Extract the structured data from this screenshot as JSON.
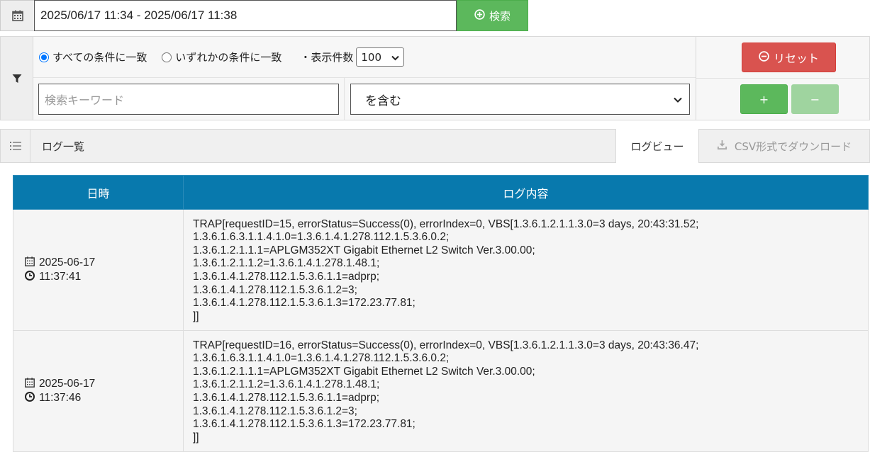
{
  "search": {
    "date_range": "2025/06/17 11:34 - 2025/06/17 11:38",
    "search_button": "検索"
  },
  "filter": {
    "match_all": "すべての条件に一致",
    "match_any": "いずれかの条件に一致",
    "count_label": "・表示件数",
    "count_value": "100",
    "keyword_placeholder": "検索キーワード",
    "condition": "を含む",
    "reset_button": "リセット",
    "add_button": "+",
    "remove_button": "−"
  },
  "tabs": {
    "title": "ログ一覧",
    "active": "ログビュー",
    "csv": "CSV形式でダウンロード"
  },
  "table": {
    "columns": [
      "日時",
      "ログ内容"
    ],
    "rows": [
      {
        "date": "2025-06-17",
        "time": "11:37:41",
        "content": "TRAP[requestID=15, errorStatus=Success(0), errorIndex=0, VBS[1.3.6.1.2.1.1.3.0=3 days, 20:43:31.52;\n1.3.6.1.6.3.1.1.4.1.0=1.3.6.1.4.1.278.112.1.5.3.6.0.2;\n1.3.6.1.2.1.1.1=APLGM352XT Gigabit Ethernet L2 Switch Ver.3.00.00;\n1.3.6.1.2.1.1.2=1.3.6.1.4.1.278.1.48.1;\n1.3.6.1.4.1.278.112.1.5.3.6.1.1=adprp;\n1.3.6.1.4.1.278.112.1.5.3.6.1.2=3;\n1.3.6.1.4.1.278.112.1.5.3.6.1.3=172.23.77.81;\n]]"
      },
      {
        "date": "2025-06-17",
        "time": "11:37:46",
        "content": "TRAP[requestID=16, errorStatus=Success(0), errorIndex=0, VBS[1.3.6.1.2.1.1.3.0=3 days, 20:43:36.47;\n1.3.6.1.6.3.1.1.4.1.0=1.3.6.1.4.1.278.112.1.5.3.6.0.2;\n1.3.6.1.2.1.1.1=APLGM352XT Gigabit Ethernet L2 Switch Ver.3.00.00;\n1.3.6.1.2.1.1.2=1.3.6.1.4.1.278.1.48.1;\n1.3.6.1.4.1.278.112.1.5.3.6.1.1=adprp;\n1.3.6.1.4.1.278.112.1.5.3.6.1.2=3;\n1.3.6.1.4.1.278.112.1.5.3.6.1.3=172.23.77.81;\n]]"
      }
    ]
  },
  "colors": {
    "header_blue": "#0879ad",
    "green": "#5cb85c",
    "red": "#d9534f"
  },
  "icons": [
    "calendar-icon",
    "plus-circle-icon",
    "filter-icon",
    "minus-circle-icon",
    "list-icon",
    "download-icon",
    "clock-icon"
  ]
}
